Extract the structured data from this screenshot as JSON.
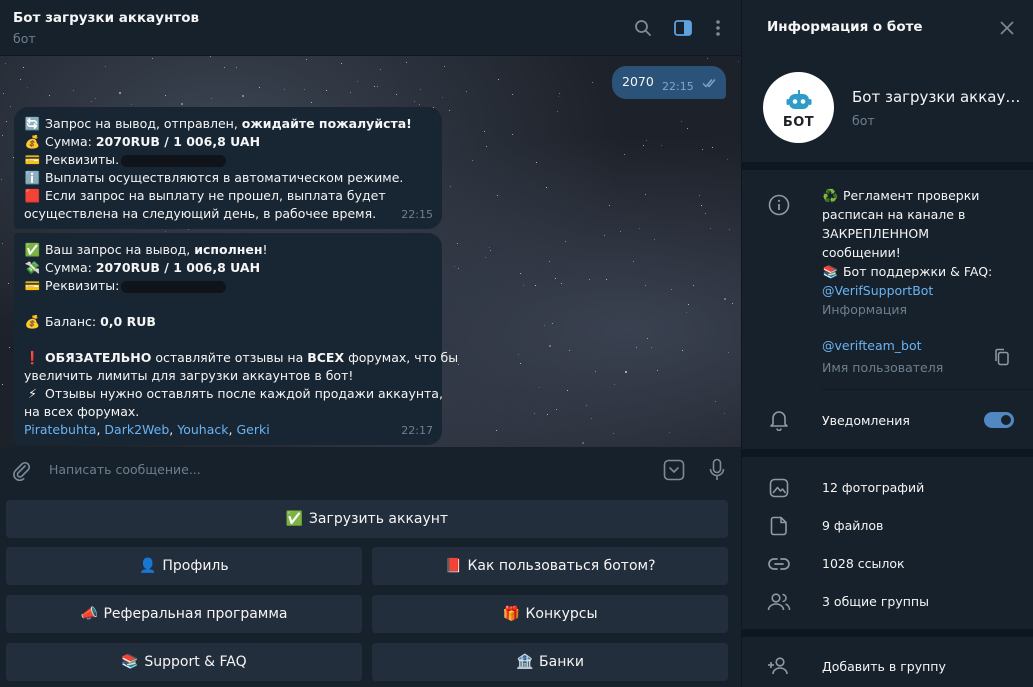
{
  "chat": {
    "title": "Бот загрузки аккаунтов",
    "subtitle": "бот",
    "icons": [
      "search-icon",
      "sidebar-toggle-icon",
      "more-vertical-icon"
    ]
  },
  "outgoing": {
    "text": "2070",
    "time": "22:15"
  },
  "msg1": {
    "l1_pre": "Запрос на вывод,  отправлен, ",
    "l1_bold": "ожидайте пожалуйста!",
    "l2_pre": "Сумма: ",
    "l2_bold": "2070RUB  / 1 006,8 UAH",
    "l3": "Реквизиты.",
    "l4": "Выплаты осуществляются в автоматическом режиме.",
    "l5": "Если запрос на выплату не прошел, выплата будет",
    "l6": "осуществлена на следующий день, в рабочее время.",
    "time": "22:15"
  },
  "msg2": {
    "l1_pre": "Ваш запрос на вывод, ",
    "l1_bold": "исполнен",
    "l1_post": "!",
    "l2_pre": "Сумма: ",
    "l2_bold": "2070RUB  / 1 006,8 UAH",
    "l3": "Реквизиты:",
    "l4_pre": "Баланс: ",
    "l4_bold": "0,0 RUB",
    "l5_bold": "ОБЯЗАТЕЛЬНО",
    "l5_mid": " оставляйте отзывы на ",
    "l5_bold2": "ВСЕХ",
    "l5_post": " форумах, что бы",
    "l6": "увеличить лимиты для загрузки аккаунтов в бот!",
    "l7": "Отзывы нужно оставлять после каждой продажи аккаунта,",
    "l8": "на всех форумах.",
    "links": [
      "Piratebuhta",
      "Dark2Web",
      "Youhack",
      "Gerki"
    ],
    "sep": ", ",
    "time": "22:17"
  },
  "composer": {
    "placeholder": "Написать сообщение..."
  },
  "keyboard": {
    "upload": "Загрузить аккаунт",
    "profile": "Профиль",
    "howto": "Как пользоваться ботом?",
    "referral": "Реферальная программа",
    "contests": "Конкурсы",
    "support": "Support & FAQ",
    "banks": "Банки"
  },
  "info": {
    "title": "Информация о боте",
    "avatar_text": "БОТ",
    "name": "Бот загрузки аккаунтов",
    "type": "бот",
    "desc_l1": "Регламент проверки",
    "desc_l2": "расписан на канале в",
    "desc_l3": "ЗАКРЕПЛЕННОМ",
    "desc_l4": "сообщении!",
    "desc_l5": "Бот поддержки & FAQ:",
    "desc_link": "@VerifSupportBot",
    "desc_label": "Информация",
    "username": "@verifteam_bot",
    "username_label": "Имя пользователя",
    "notifications": "Уведомления",
    "photos": "12 фотографий",
    "files": "9 файлов",
    "links": "1028 ссылок",
    "groups": "3 общие группы",
    "add_group": "Добавить в группу"
  },
  "colors": {
    "bg": "#17212b",
    "bubble_in": "#182533",
    "bubble_out": "#2b5278",
    "button": "#232e3c",
    "accent": "#5288c1",
    "link": "#6ab3f3",
    "muted": "#6d7f8f"
  }
}
